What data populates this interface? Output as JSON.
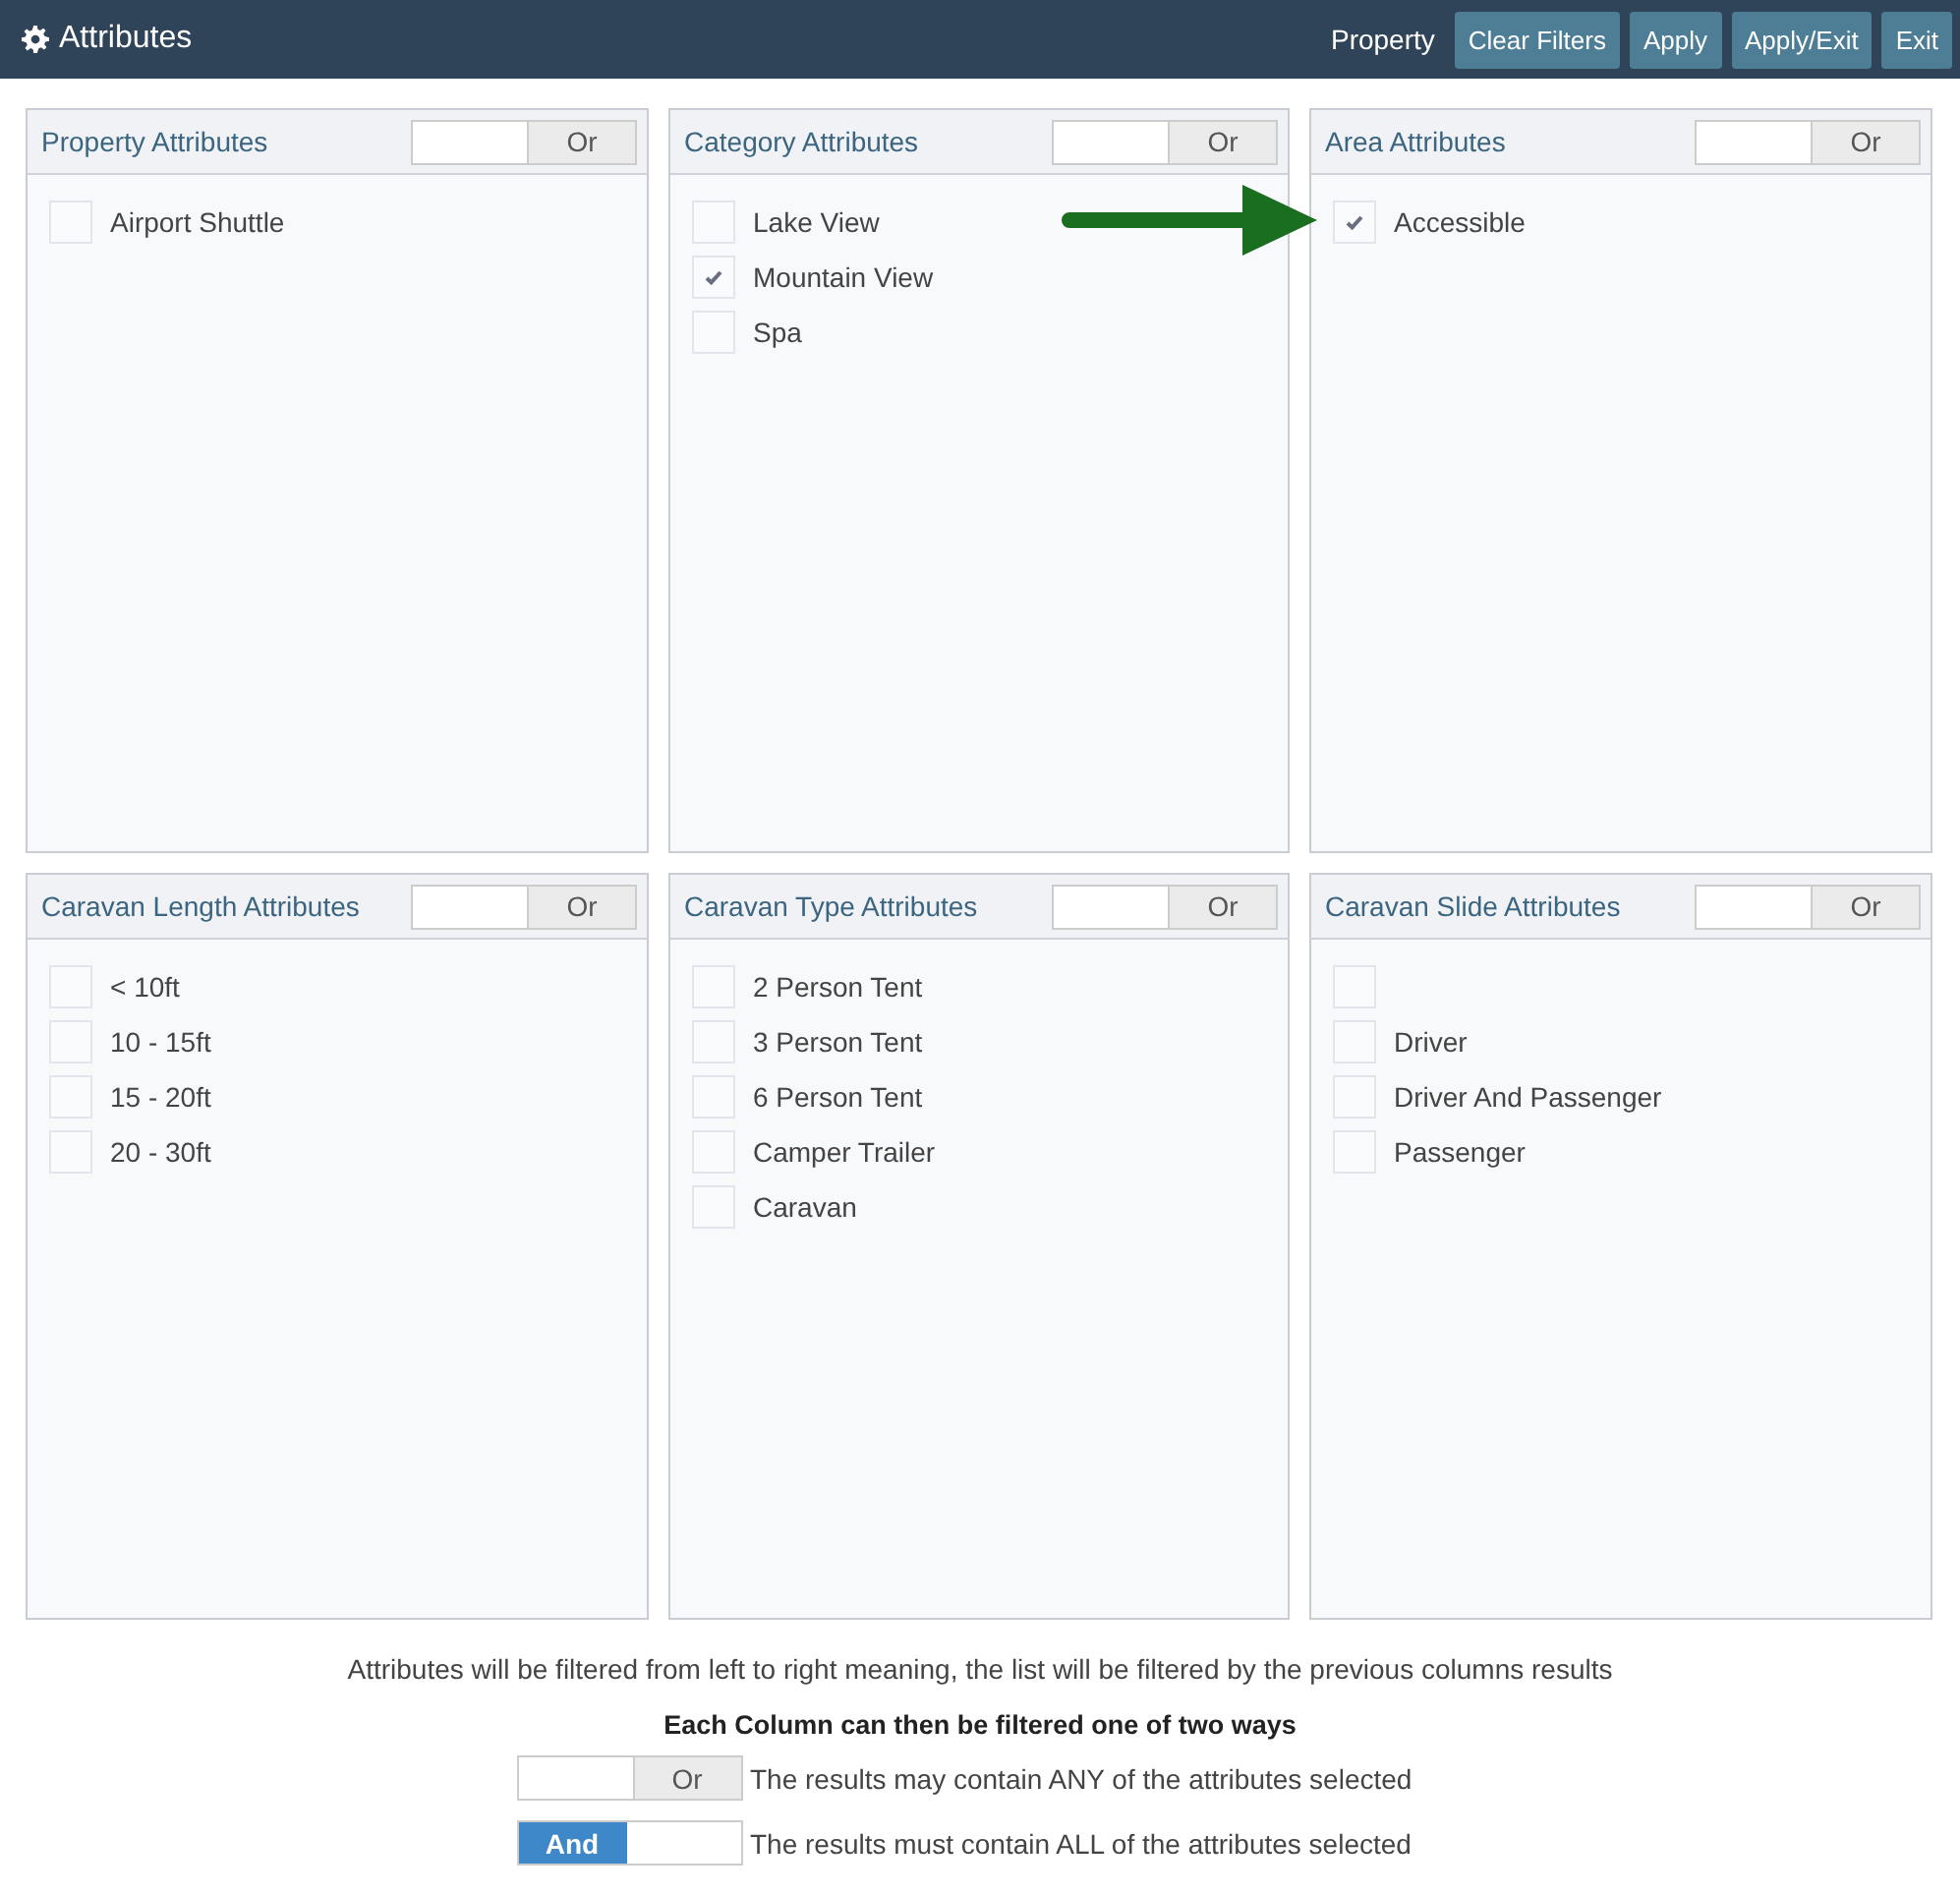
{
  "header": {
    "title": "Attributes",
    "context": "Property",
    "buttons": [
      "Clear Filters",
      "Apply",
      "Apply/Exit",
      "Exit"
    ]
  },
  "panels": [
    {
      "title": "Property Attributes",
      "toggle": {
        "label": "Or",
        "on": false
      },
      "items": [
        {
          "label": "Airport Shuttle",
          "checked": false
        }
      ]
    },
    {
      "title": "Category Attributes",
      "toggle": {
        "label": "Or",
        "on": false
      },
      "items": [
        {
          "label": "Lake View",
          "checked": false
        },
        {
          "label": "Mountain View",
          "checked": true
        },
        {
          "label": "Spa",
          "checked": false
        }
      ]
    },
    {
      "title": "Area Attributes",
      "toggle": {
        "label": "Or",
        "on": false
      },
      "items": [
        {
          "label": "Accessible",
          "checked": true
        }
      ]
    },
    {
      "title": "Caravan Length Attributes",
      "toggle": {
        "label": "Or",
        "on": false
      },
      "items": [
        {
          "label": "< 10ft",
          "checked": false
        },
        {
          "label": "10 - 15ft",
          "checked": false
        },
        {
          "label": "15 - 20ft",
          "checked": false
        },
        {
          "label": "20 - 30ft",
          "checked": false
        }
      ]
    },
    {
      "title": "Caravan Type Attributes",
      "toggle": {
        "label": "Or",
        "on": false
      },
      "items": [
        {
          "label": "2 Person Tent",
          "checked": false
        },
        {
          "label": "3 Person Tent",
          "checked": false
        },
        {
          "label": "6 Person Tent",
          "checked": false
        },
        {
          "label": "Camper Trailer",
          "checked": false
        },
        {
          "label": "Caravan",
          "checked": false
        }
      ]
    },
    {
      "title": "Caravan Slide Attributes",
      "toggle": {
        "label": "Or",
        "on": false
      },
      "items": [
        {
          "checked": false
        },
        {
          "label": "Driver",
          "checked": false
        },
        {
          "label": "Driver And Passenger",
          "checked": false
        },
        {
          "label": "Passenger",
          "checked": false
        }
      ]
    }
  ],
  "help": {
    "note": "Attributes will be filtered from left to right meaning, the list will be filtered by the previous columns results",
    "heading": "Each Column can then be filtered one of two ways",
    "examples": [
      {
        "toggle": {
          "label": "Or",
          "on": false
        },
        "text": "The results may contain ANY of the attributes selected"
      },
      {
        "toggle": {
          "label": "And",
          "on": true
        },
        "text": "The results must contain ALL of the attributes selected"
      }
    ]
  }
}
